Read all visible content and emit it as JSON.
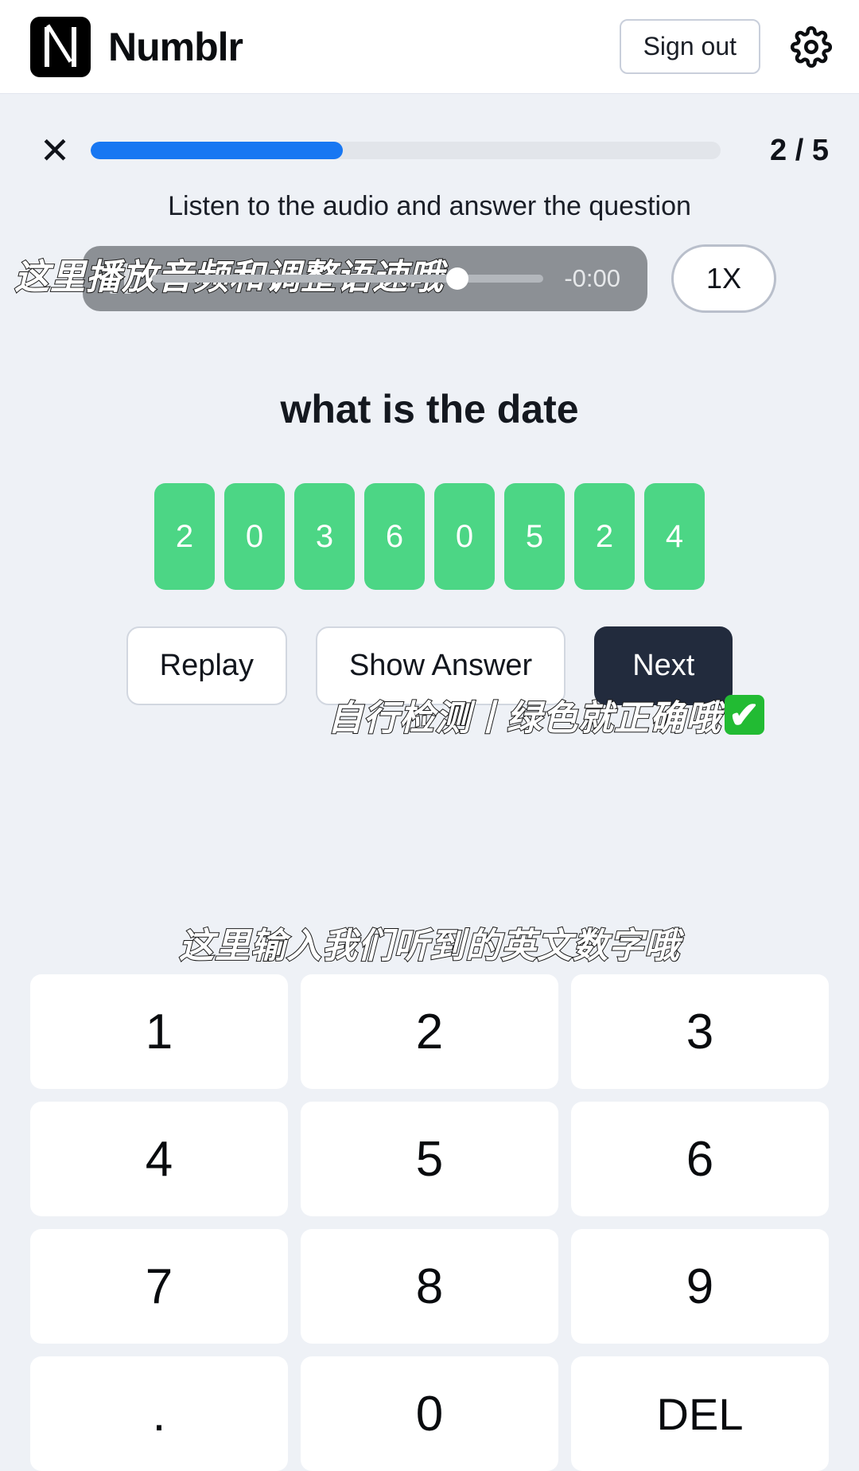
{
  "header": {
    "brand": "Numblr",
    "logo_icon": "numblr-n-logo",
    "signout_label": "Sign out",
    "settings_icon": "gear-icon"
  },
  "quiz": {
    "close_icon": "close-x-icon",
    "progress_percent": 40,
    "counter": "2 / 5",
    "instruction": "Listen to the audio and answer the question",
    "question": "what is the date"
  },
  "audio": {
    "state_icon": "pause-icon",
    "seek_position_percent": 78,
    "time_remaining": "-0:00",
    "speed_label": "1X"
  },
  "answer": {
    "digits": [
      "2",
      "0",
      "3",
      "6",
      "0",
      "5",
      "2",
      "4"
    ],
    "tile_color": "#4cd685"
  },
  "actions": {
    "replay_label": "Replay",
    "show_answer_label": "Show Answer",
    "next_label": "Next",
    "next_color": "#222b3d"
  },
  "annotations": {
    "audio_hint": "这里播放音频和调整语速哦",
    "check_hint": "自行检测丨绿色就正确哦",
    "check_icon": "✔",
    "keypad_hint": "这里输入我们听到的英文数字哦"
  },
  "keypad": {
    "keys": [
      "1",
      "2",
      "3",
      "4",
      "5",
      "6",
      "7",
      "8",
      "9",
      ".",
      "0",
      "DEL"
    ]
  },
  "colors": {
    "background": "#eef1f6",
    "accent": "#1877f2"
  }
}
